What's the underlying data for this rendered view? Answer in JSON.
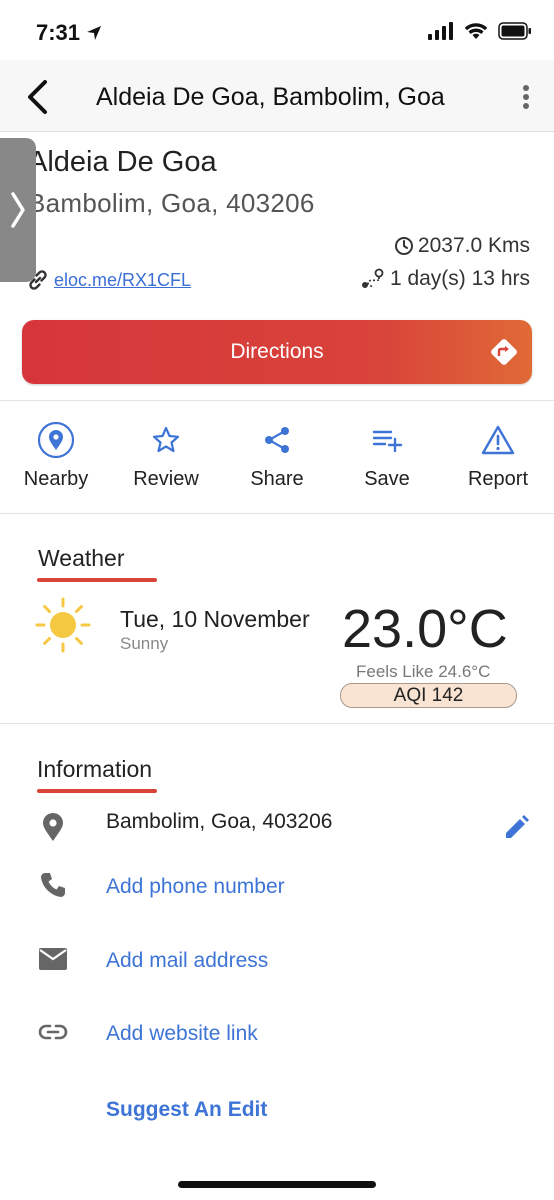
{
  "status_bar": {
    "time": "7:31"
  },
  "header": {
    "title": "Aldeia De Goa, Bambolim, Goa"
  },
  "place": {
    "name": "Aldeia De Goa",
    "address": "Bambolim, Goa, 403206",
    "distance": "2037.0 Kms",
    "eloc_link": "eloc.me/RX1CFL",
    "duration": "1 day(s) 13 hrs"
  },
  "directions_label": "Directions",
  "actions": [
    {
      "label": "Nearby",
      "icon": "location-pin-icon"
    },
    {
      "label": "Review",
      "icon": "star-icon"
    },
    {
      "label": "Share",
      "icon": "share-icon"
    },
    {
      "label": "Save",
      "icon": "playlist-add-icon"
    },
    {
      "label": "Report",
      "icon": "warning-icon"
    }
  ],
  "weather": {
    "title": "Weather",
    "date": "Tue, 10 November",
    "condition": "Sunny",
    "temperature": "23.0°C",
    "feels_like": "Feels Like 24.6°C",
    "aqi": "AQI 142"
  },
  "information": {
    "title": "Information",
    "address": "Bambolim, Goa, 403206",
    "phone_link": "Add phone number",
    "mail_link": "Add mail address",
    "website_link": "Add website link",
    "suggest_edit": "Suggest An Edit"
  },
  "colors": {
    "accent_red": "#d9453b",
    "link_blue": "#3d74d6",
    "sun_yellow": "#f5c842"
  }
}
